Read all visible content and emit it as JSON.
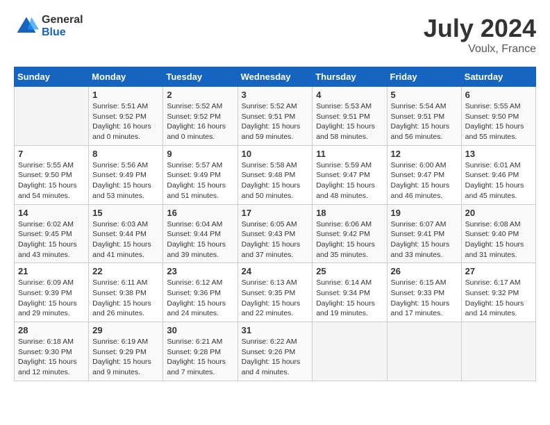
{
  "header": {
    "logo_general": "General",
    "logo_blue": "Blue",
    "month_year": "July 2024",
    "location": "Voulx, France"
  },
  "columns": [
    "Sunday",
    "Monday",
    "Tuesday",
    "Wednesday",
    "Thursday",
    "Friday",
    "Saturday"
  ],
  "weeks": [
    [
      {
        "day": "",
        "info": ""
      },
      {
        "day": "1",
        "info": "Sunrise: 5:51 AM\nSunset: 9:52 PM\nDaylight: 16 hours\nand 0 minutes."
      },
      {
        "day": "2",
        "info": "Sunrise: 5:52 AM\nSunset: 9:52 PM\nDaylight: 16 hours\nand 0 minutes."
      },
      {
        "day": "3",
        "info": "Sunrise: 5:52 AM\nSunset: 9:51 PM\nDaylight: 15 hours\nand 59 minutes."
      },
      {
        "day": "4",
        "info": "Sunrise: 5:53 AM\nSunset: 9:51 PM\nDaylight: 15 hours\nand 58 minutes."
      },
      {
        "day": "5",
        "info": "Sunrise: 5:54 AM\nSunset: 9:51 PM\nDaylight: 15 hours\nand 56 minutes."
      },
      {
        "day": "6",
        "info": "Sunrise: 5:55 AM\nSunset: 9:50 PM\nDaylight: 15 hours\nand 55 minutes."
      }
    ],
    [
      {
        "day": "7",
        "info": "Sunrise: 5:55 AM\nSunset: 9:50 PM\nDaylight: 15 hours\nand 54 minutes."
      },
      {
        "day": "8",
        "info": "Sunrise: 5:56 AM\nSunset: 9:49 PM\nDaylight: 15 hours\nand 53 minutes."
      },
      {
        "day": "9",
        "info": "Sunrise: 5:57 AM\nSunset: 9:49 PM\nDaylight: 15 hours\nand 51 minutes."
      },
      {
        "day": "10",
        "info": "Sunrise: 5:58 AM\nSunset: 9:48 PM\nDaylight: 15 hours\nand 50 minutes."
      },
      {
        "day": "11",
        "info": "Sunrise: 5:59 AM\nSunset: 9:47 PM\nDaylight: 15 hours\nand 48 minutes."
      },
      {
        "day": "12",
        "info": "Sunrise: 6:00 AM\nSunset: 9:47 PM\nDaylight: 15 hours\nand 46 minutes."
      },
      {
        "day": "13",
        "info": "Sunrise: 6:01 AM\nSunset: 9:46 PM\nDaylight: 15 hours\nand 45 minutes."
      }
    ],
    [
      {
        "day": "14",
        "info": "Sunrise: 6:02 AM\nSunset: 9:45 PM\nDaylight: 15 hours\nand 43 minutes."
      },
      {
        "day": "15",
        "info": "Sunrise: 6:03 AM\nSunset: 9:44 PM\nDaylight: 15 hours\nand 41 minutes."
      },
      {
        "day": "16",
        "info": "Sunrise: 6:04 AM\nSunset: 9:44 PM\nDaylight: 15 hours\nand 39 minutes."
      },
      {
        "day": "17",
        "info": "Sunrise: 6:05 AM\nSunset: 9:43 PM\nDaylight: 15 hours\nand 37 minutes."
      },
      {
        "day": "18",
        "info": "Sunrise: 6:06 AM\nSunset: 9:42 PM\nDaylight: 15 hours\nand 35 minutes."
      },
      {
        "day": "19",
        "info": "Sunrise: 6:07 AM\nSunset: 9:41 PM\nDaylight: 15 hours\nand 33 minutes."
      },
      {
        "day": "20",
        "info": "Sunrise: 6:08 AM\nSunset: 9:40 PM\nDaylight: 15 hours\nand 31 minutes."
      }
    ],
    [
      {
        "day": "21",
        "info": "Sunrise: 6:09 AM\nSunset: 9:39 PM\nDaylight: 15 hours\nand 29 minutes."
      },
      {
        "day": "22",
        "info": "Sunrise: 6:11 AM\nSunset: 9:38 PM\nDaylight: 15 hours\nand 26 minutes."
      },
      {
        "day": "23",
        "info": "Sunrise: 6:12 AM\nSunset: 9:36 PM\nDaylight: 15 hours\nand 24 minutes."
      },
      {
        "day": "24",
        "info": "Sunrise: 6:13 AM\nSunset: 9:35 PM\nDaylight: 15 hours\nand 22 minutes."
      },
      {
        "day": "25",
        "info": "Sunrise: 6:14 AM\nSunset: 9:34 PM\nDaylight: 15 hours\nand 19 minutes."
      },
      {
        "day": "26",
        "info": "Sunrise: 6:15 AM\nSunset: 9:33 PM\nDaylight: 15 hours\nand 17 minutes."
      },
      {
        "day": "27",
        "info": "Sunrise: 6:17 AM\nSunset: 9:32 PM\nDaylight: 15 hours\nand 14 minutes."
      }
    ],
    [
      {
        "day": "28",
        "info": "Sunrise: 6:18 AM\nSunset: 9:30 PM\nDaylight: 15 hours\nand 12 minutes."
      },
      {
        "day": "29",
        "info": "Sunrise: 6:19 AM\nSunset: 9:29 PM\nDaylight: 15 hours\nand 9 minutes."
      },
      {
        "day": "30",
        "info": "Sunrise: 6:21 AM\nSunset: 9:28 PM\nDaylight: 15 hours\nand 7 minutes."
      },
      {
        "day": "31",
        "info": "Sunrise: 6:22 AM\nSunset: 9:26 PM\nDaylight: 15 hours\nand 4 minutes."
      },
      {
        "day": "",
        "info": ""
      },
      {
        "day": "",
        "info": ""
      },
      {
        "day": "",
        "info": ""
      }
    ]
  ]
}
